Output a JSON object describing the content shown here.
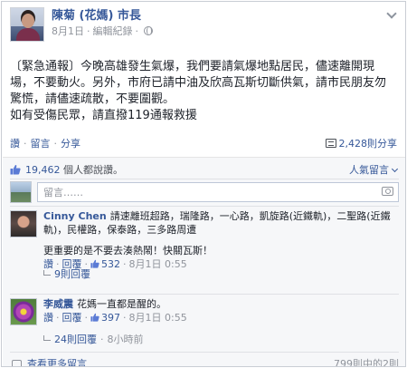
{
  "post": {
    "author": "陳菊 (花媽) 市長",
    "date": "8月1日",
    "edit_history": "編輯紀錄",
    "body": "〔緊急通報〕今晚高雄發生氣爆，我們要請氣爆地點居民，儘速離開現場，不要動火。另外，市府已請中油及欣高瓦斯切斷供氣，請市民朋友勿驚慌，請儘速疏散，不要圍觀。\n如有受傷民眾，請直撥119通報救援"
  },
  "actions": {
    "like": "讚",
    "comment": "留言",
    "share": "分享",
    "share_count": "2,428則分享"
  },
  "likes": {
    "count": "19,462",
    "suffix": " 個人都說讚。",
    "sort_label": "人氣留言"
  },
  "composer": {
    "placeholder": "留言……"
  },
  "comments": [
    {
      "author": "Cinny Chen",
      "text": "請速離班超路，瑞隆路，一心路，凱旋路(近鐵軌)，二聖路(近鐵軌)，民權路，保泰路，三多路周遭",
      "text2": "更重要的是不要去湊熱鬧！快關瓦斯！",
      "like": "讚",
      "reply": "回覆",
      "likes": "532",
      "date": "8月1日 0:55",
      "replies": "9則回覆"
    },
    {
      "author": "李威震",
      "text": "花媽一直都是醒的。",
      "like": "讚",
      "reply": "回覆",
      "likes": "397",
      "date": "8月1日 0:55",
      "replies": "24則回覆",
      "replies_time": "8小時前"
    }
  ],
  "footer": {
    "more_comments": "查看更多留言",
    "comment_count": "799則中的2則"
  },
  "colors": {
    "link": "#365899",
    "meta": "#90949c",
    "ufi_background": "#f6f7f9"
  }
}
